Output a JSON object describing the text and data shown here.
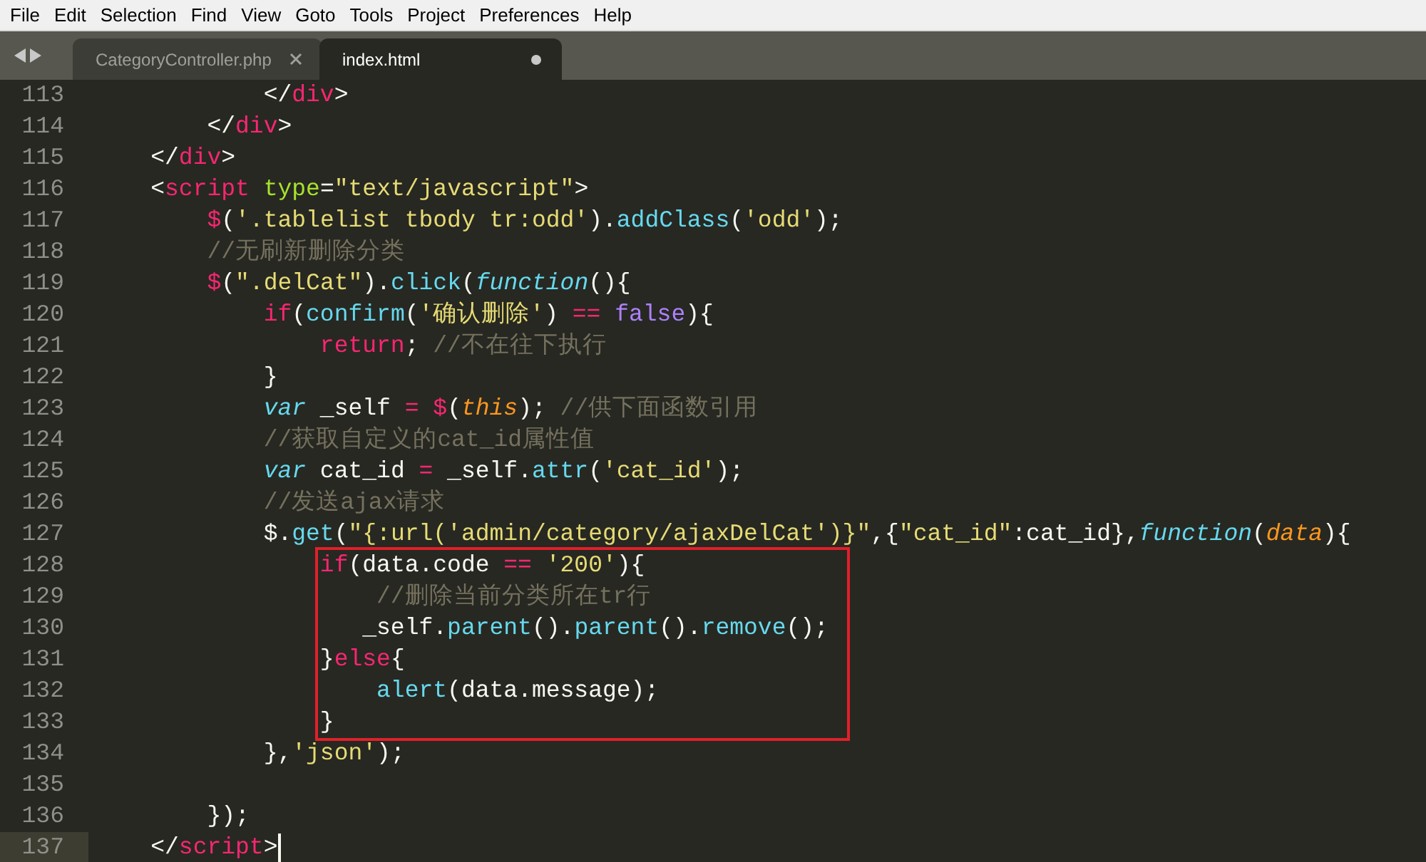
{
  "menu": [
    "File",
    "Edit",
    "Selection",
    "Find",
    "View",
    "Goto",
    "Tools",
    "Project",
    "Preferences",
    "Help"
  ],
  "tabs": [
    {
      "label": "CategoryController.php",
      "selected": false,
      "modified": false
    },
    {
      "label": "index.html",
      "selected": true,
      "modified": true
    }
  ],
  "lines": [
    {
      "number": "113",
      "current": false,
      "boxed": false,
      "tokens": [
        {
          "kind": "plain",
          "text": "            </"
        },
        {
          "kind": "tag",
          "text": "div"
        },
        {
          "kind": "plain",
          "text": ">"
        }
      ]
    },
    {
      "number": "114",
      "current": false,
      "boxed": false,
      "tokens": [
        {
          "kind": "plain",
          "text": "        </"
        },
        {
          "kind": "tag",
          "text": "div"
        },
        {
          "kind": "plain",
          "text": ">"
        }
      ]
    },
    {
      "number": "115",
      "current": false,
      "boxed": false,
      "tokens": [
        {
          "kind": "plain",
          "text": "    </"
        },
        {
          "kind": "tag",
          "text": "div"
        },
        {
          "kind": "plain",
          "text": ">"
        }
      ]
    },
    {
      "number": "116",
      "current": false,
      "boxed": false,
      "tokens": [
        {
          "kind": "plain",
          "text": "    <"
        },
        {
          "kind": "tag",
          "text": "script"
        },
        {
          "kind": "attr",
          "text": " type"
        },
        {
          "kind": "plain",
          "text": "="
        },
        {
          "kind": "string",
          "text": "\"text/javascript\""
        },
        {
          "kind": "plain",
          "text": ">"
        }
      ]
    },
    {
      "number": "117",
      "current": false,
      "boxed": false,
      "tokens": [
        {
          "kind": "tag",
          "text": "        $"
        },
        {
          "kind": "plain",
          "text": "("
        },
        {
          "kind": "string",
          "text": "'.tablelist tbody tr:odd'"
        },
        {
          "kind": "plain",
          "text": ")."
        },
        {
          "kind": "func",
          "text": "addClass"
        },
        {
          "kind": "plain",
          "text": "("
        },
        {
          "kind": "string",
          "text": "'odd'"
        },
        {
          "kind": "plain",
          "text": ");"
        }
      ]
    },
    {
      "number": "118",
      "current": false,
      "boxed": false,
      "tokens": [
        {
          "kind": "comment",
          "text": "        //无刷新删除分类"
        }
      ]
    },
    {
      "number": "119",
      "current": false,
      "boxed": false,
      "tokens": [
        {
          "kind": "tag",
          "text": "        $"
        },
        {
          "kind": "plain",
          "text": "("
        },
        {
          "kind": "string",
          "text": "\".delCat\""
        },
        {
          "kind": "plain",
          "text": ")."
        },
        {
          "kind": "func",
          "text": "click"
        },
        {
          "kind": "plain",
          "text": "("
        },
        {
          "kind": "storage",
          "text": "function"
        },
        {
          "kind": "plain",
          "text": "(){"
        }
      ]
    },
    {
      "number": "120",
      "current": false,
      "boxed": false,
      "tokens": [
        {
          "kind": "tag",
          "text": "            if"
        },
        {
          "kind": "plain",
          "text": "("
        },
        {
          "kind": "func",
          "text": "confirm"
        },
        {
          "kind": "plain",
          "text": "("
        },
        {
          "kind": "string",
          "text": "'确认删除'"
        },
        {
          "kind": "plain",
          "text": ") "
        },
        {
          "kind": "tag",
          "text": "=="
        },
        {
          "kind": "const",
          "text": " false"
        },
        {
          "kind": "plain",
          "text": "){"
        }
      ]
    },
    {
      "number": "121",
      "current": false,
      "boxed": false,
      "tokens": [
        {
          "kind": "tag",
          "text": "                return"
        },
        {
          "kind": "plain",
          "text": "; "
        },
        {
          "kind": "comment",
          "text": "//不在往下执行"
        }
      ]
    },
    {
      "number": "122",
      "current": false,
      "boxed": false,
      "tokens": [
        {
          "kind": "plain",
          "text": "            }"
        }
      ]
    },
    {
      "number": "123",
      "current": false,
      "boxed": false,
      "tokens": [
        {
          "kind": "storage",
          "text": "            var"
        },
        {
          "kind": "plain",
          "text": " _self "
        },
        {
          "kind": "tag",
          "text": "= $"
        },
        {
          "kind": "plain",
          "text": "("
        },
        {
          "kind": "param",
          "text": "this"
        },
        {
          "kind": "plain",
          "text": "); "
        },
        {
          "kind": "comment",
          "text": "//供下面函数引用"
        }
      ]
    },
    {
      "number": "124",
      "current": false,
      "boxed": false,
      "tokens": [
        {
          "kind": "comment",
          "text": "            //获取自定义的cat_id属性值"
        }
      ]
    },
    {
      "number": "125",
      "current": false,
      "boxed": false,
      "tokens": [
        {
          "kind": "storage",
          "text": "            var"
        },
        {
          "kind": "plain",
          "text": " cat_id "
        },
        {
          "kind": "tag",
          "text": "="
        },
        {
          "kind": "plain",
          "text": " _self."
        },
        {
          "kind": "func",
          "text": "attr"
        },
        {
          "kind": "plain",
          "text": "("
        },
        {
          "kind": "string",
          "text": "'cat_id'"
        },
        {
          "kind": "plain",
          "text": ");"
        }
      ]
    },
    {
      "number": "126",
      "current": false,
      "boxed": false,
      "tokens": [
        {
          "kind": "comment",
          "text": "            //发送ajax请求"
        }
      ]
    },
    {
      "number": "127",
      "current": false,
      "boxed": false,
      "tokens": [
        {
          "kind": "plain",
          "text": "            $."
        },
        {
          "kind": "func",
          "text": "get"
        },
        {
          "kind": "plain",
          "text": "("
        },
        {
          "kind": "string",
          "text": "\"{:url('admin/category/ajaxDelCat')}\""
        },
        {
          "kind": "plain",
          "text": ",{"
        },
        {
          "kind": "string",
          "text": "\"cat_id\""
        },
        {
          "kind": "plain",
          "text": ":cat_id},"
        },
        {
          "kind": "storage",
          "text": "function"
        },
        {
          "kind": "plain",
          "text": "("
        },
        {
          "kind": "param",
          "text": "data"
        },
        {
          "kind": "plain",
          "text": "){"
        }
      ]
    },
    {
      "number": "128",
      "current": false,
      "boxed": true,
      "tokens": [
        {
          "kind": "tag",
          "text": "                if"
        },
        {
          "kind": "plain",
          "text": "(data.code "
        },
        {
          "kind": "tag",
          "text": "=="
        },
        {
          "kind": "string",
          "text": " '200'"
        },
        {
          "kind": "plain",
          "text": "){"
        }
      ]
    },
    {
      "number": "129",
      "current": false,
      "boxed": true,
      "tokens": [
        {
          "kind": "comment",
          "text": "                    //删除当前分类所在tr行"
        }
      ]
    },
    {
      "number": "130",
      "current": false,
      "boxed": true,
      "tokens": [
        {
          "kind": "plain",
          "text": "                   _self."
        },
        {
          "kind": "func",
          "text": "parent"
        },
        {
          "kind": "plain",
          "text": "()."
        },
        {
          "kind": "func",
          "text": "parent"
        },
        {
          "kind": "plain",
          "text": "()."
        },
        {
          "kind": "func",
          "text": "remove"
        },
        {
          "kind": "plain",
          "text": "();"
        }
      ]
    },
    {
      "number": "131",
      "current": false,
      "boxed": true,
      "tokens": [
        {
          "kind": "plain",
          "text": "                }"
        },
        {
          "kind": "tag",
          "text": "else"
        },
        {
          "kind": "plain",
          "text": "{"
        }
      ]
    },
    {
      "number": "132",
      "current": false,
      "boxed": true,
      "tokens": [
        {
          "kind": "func",
          "text": "                    alert"
        },
        {
          "kind": "plain",
          "text": "(data.message);"
        }
      ]
    },
    {
      "number": "133",
      "current": false,
      "boxed": true,
      "tokens": [
        {
          "kind": "plain",
          "text": "                }"
        }
      ]
    },
    {
      "number": "134",
      "current": false,
      "boxed": false,
      "tokens": [
        {
          "kind": "plain",
          "text": "            },"
        },
        {
          "kind": "string",
          "text": "'json'"
        },
        {
          "kind": "plain",
          "text": ");"
        }
      ]
    },
    {
      "number": "135",
      "current": false,
      "boxed": false
    },
    {
      "number": "136",
      "current": false,
      "boxed": false,
      "tokens": [
        {
          "kind": "plain",
          "text": "        });"
        }
      ]
    },
    {
      "number": "137",
      "current": true,
      "boxed": false,
      "tokens": [
        {
          "kind": "plain",
          "text": "    </"
        },
        {
          "kind": "tag",
          "text": "script"
        },
        {
          "kind": "plain",
          "text": ">"
        }
      ]
    }
  ]
}
